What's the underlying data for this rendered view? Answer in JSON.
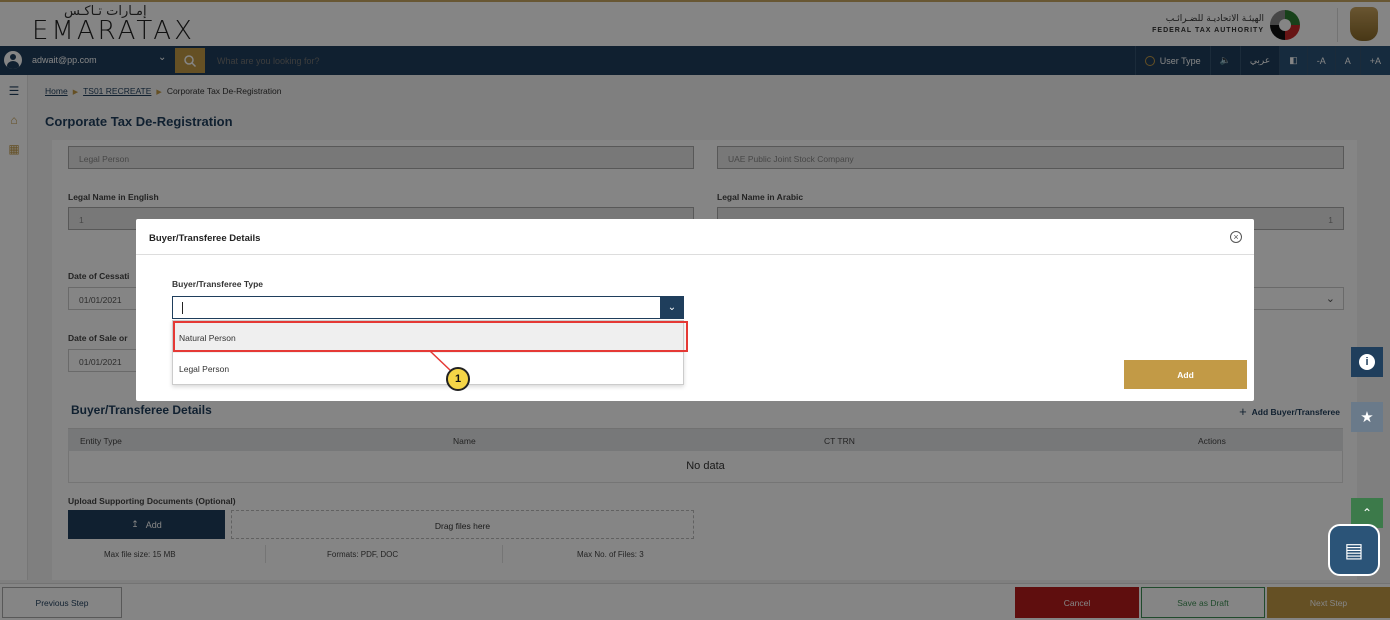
{
  "header": {
    "logo_arabic": "إمـارات تـاكـس",
    "logo_english": "EMARATAX",
    "fta_arabic": "الهيئـة الاتحاديـة للضـرائـب",
    "fta_english": "FEDERAL TAX AUTHORITY"
  },
  "toolbar": {
    "user_email": "adwait@pp.com",
    "search_placeholder": "What are you looking for?",
    "user_type_label": "User Type",
    "language_label": "عربي",
    "font_decrease": "-A",
    "font_reset": "A",
    "font_increase": "+A"
  },
  "breadcrumb": {
    "home": "Home",
    "level2": "TS01 RECREATE",
    "current": "Corporate Tax De-Registration"
  },
  "page_title": "Corporate Tax De-Registration",
  "form": {
    "legal_type_value": "Legal Person",
    "company_type_value": "UAE Public Joint Stock Company",
    "legal_name_en_label": "Legal Name in English",
    "legal_name_en_value": "1",
    "legal_name_ar_label": "Legal Name in Arabic",
    "legal_name_ar_value": "1",
    "cessation_label": "Date of Cessati",
    "cessation_value": "01/01/2021",
    "sale_label": "Date of Sale or",
    "sale_value": "01/01/2021"
  },
  "buyer_section": {
    "title": "Buyer/Transferee Details",
    "add_label": "Add Buyer/Transferee",
    "columns": [
      "Entity Type",
      "Name",
      "CT TRN",
      "Actions"
    ],
    "empty_text": "No data"
  },
  "upload": {
    "label": "Upload Supporting Documents (Optional)",
    "add_label": "Add",
    "drop_text": "Drag files here",
    "max_size": "Max file size: 15 MB",
    "formats": "Formats: PDF, DOC",
    "max_files": "Max No. of Files: 3"
  },
  "footer": {
    "previous": "Previous Step",
    "cancel": "Cancel",
    "save_draft": "Save as Draft",
    "next": "Next Step"
  },
  "modal": {
    "title": "Buyer/Transferee Details",
    "field_label": "Buyer/Transferee Type",
    "options": [
      "Natural Person",
      "Legal Person"
    ],
    "add_button": "Add"
  },
  "callout": {
    "number": "1"
  },
  "colors": {
    "navy": "#1f3e5c",
    "gold": "#c29a46",
    "cancel_red": "#b71c1c",
    "draft_green": "#3f8f55",
    "highlight_red": "#e53935"
  }
}
